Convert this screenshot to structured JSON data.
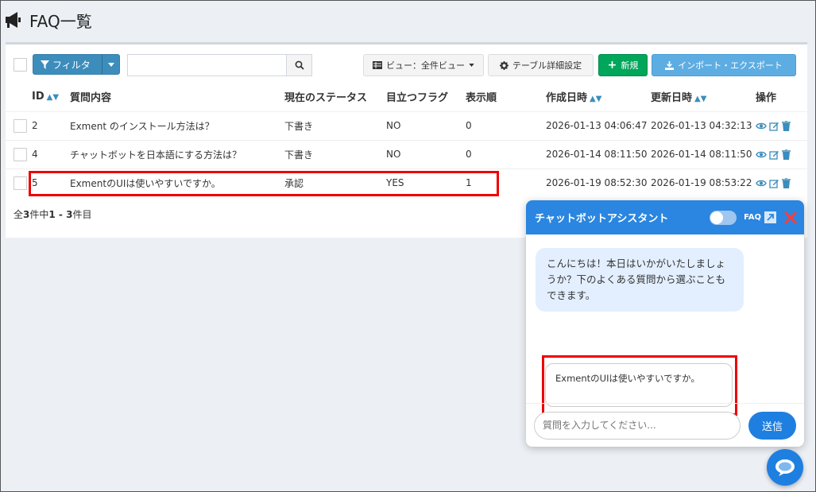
{
  "page": {
    "title": "FAQ一覧"
  },
  "toolbar": {
    "filter_label": "フィルタ",
    "search_value": "",
    "view_label": "ビュー：全件ビュー",
    "table_settings_label": "テーブル詳細設定",
    "new_label": "新規",
    "import_export_label": "インポート・エクスポート"
  },
  "table": {
    "columns": [
      "ID",
      "質問内容",
      "現在のステータス",
      "目立つフラグ",
      "表示順",
      "作成日時",
      "更新日時",
      "操作"
    ],
    "rows": [
      {
        "id": "2",
        "question": "Exment のインストール方法は？",
        "status": "下書き",
        "flag": "NO",
        "order": "0",
        "created": "2026-01-13 04:06:47",
        "updated": "2026-01-13 04:32:13"
      },
      {
        "id": "4",
        "question": "チャットボットを日本語にする方法は？",
        "status": "下書き",
        "flag": "NO",
        "order": "0",
        "created": "2026-01-14 08:11:50",
        "updated": "2026-01-14 08:11:50"
      },
      {
        "id": "5",
        "question": "ExmentのUIは使いやすいですか。",
        "status": "承認",
        "flag": "YES",
        "order": "1",
        "created": "2026-01-19 08:52:30",
        "updated": "2026-01-19 08:53:22"
      }
    ],
    "pager": {
      "prefix": "全",
      "total": "3",
      "mid": "件中",
      "range": "1 - 3",
      "suffix": "件目"
    }
  },
  "chat": {
    "title": "チャットボットアシスタント",
    "faq_label": "FAQ",
    "greeting": "こんにちは！本日はいかがいたしましょうか？下のよくある質問から選ぶこともできます。",
    "suggestion": "ExmentのUIは使いやすいですか。",
    "input_placeholder": "質問を入力してください...",
    "send_label": "送信"
  },
  "colors": {
    "primary": "#3c8dbc",
    "success": "#00a65a",
    "chat_header": "#2a86e0",
    "highlight": "#e00000"
  }
}
